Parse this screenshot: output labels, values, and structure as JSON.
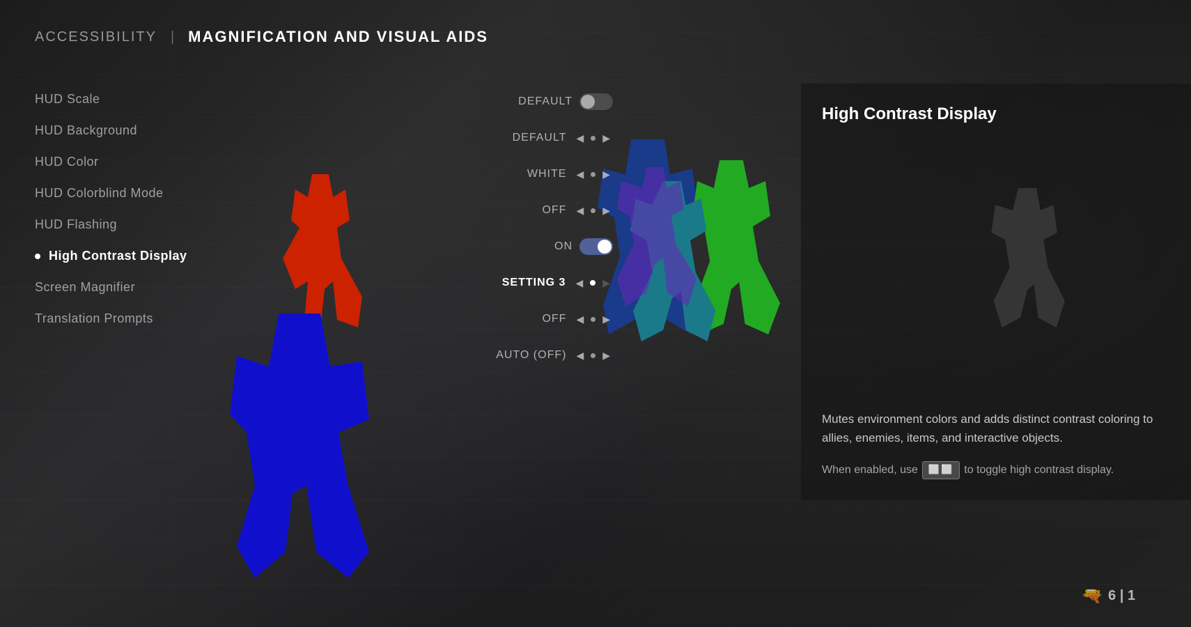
{
  "header": {
    "section_label": "ACCESSIBILITY",
    "divider": "|",
    "page_title": "MAGNIFICATION AND VISUAL AIDS"
  },
  "settings": {
    "items": [
      {
        "id": "hud-scale",
        "label": "HUD Scale",
        "active": false
      },
      {
        "id": "hud-background",
        "label": "HUD Background",
        "active": false
      },
      {
        "id": "hud-color",
        "label": "HUD Color",
        "active": false
      },
      {
        "id": "hud-colorblind-mode",
        "label": "HUD Colorblind Mode",
        "active": false
      },
      {
        "id": "hud-flashing",
        "label": "HUD Flashing",
        "active": false
      },
      {
        "id": "high-contrast-display",
        "label": "High Contrast Display",
        "active": true,
        "bullet": true
      },
      {
        "id": "screen-magnifier",
        "label": "Screen Magnifier",
        "active": false
      },
      {
        "id": "translation-prompts",
        "label": "Translation Prompts",
        "active": false
      }
    ]
  },
  "controls": {
    "rows": [
      {
        "id": "hud-scale-ctrl",
        "type": "toggle",
        "value": "DEFAULT",
        "toggle_on": false
      },
      {
        "id": "hud-background-ctrl",
        "type": "arrows",
        "value": "DEFAULT"
      },
      {
        "id": "hud-color-ctrl",
        "type": "arrows",
        "value": "WHITE"
      },
      {
        "id": "hud-colorblind-ctrl",
        "type": "arrows",
        "value": "OFF"
      },
      {
        "id": "hud-flashing-ctrl",
        "type": "toggle",
        "value": "ON",
        "toggle_on": true
      },
      {
        "id": "high-contrast-ctrl",
        "type": "arrows",
        "value": "SETTING 3",
        "active": true
      },
      {
        "id": "screen-magnifier-ctrl",
        "type": "arrows",
        "value": "OFF"
      },
      {
        "id": "translation-prompts-ctrl",
        "type": "arrows",
        "value": "AUTO (OFF)"
      }
    ]
  },
  "info_panel": {
    "title": "High Contrast Display",
    "description": "Mutes environment colors and adds distinct contrast coloring to allies, enemies, items, and interactive objects.",
    "hint_prefix": "When enabled, use",
    "hint_key": "⬜⬜",
    "hint_suffix": "to toggle high contrast display.",
    "key_symbol": "□□□"
  },
  "hud": {
    "ammo_current": "6",
    "ammo_reserve": "1"
  }
}
